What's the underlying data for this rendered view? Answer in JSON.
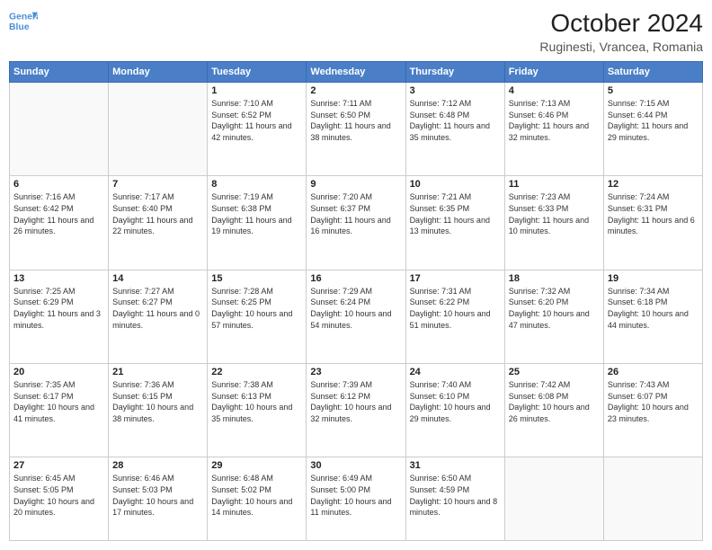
{
  "header": {
    "logo_line1": "General",
    "logo_line2": "Blue",
    "title": "October 2024",
    "subtitle": "Ruginesti, Vrancea, Romania"
  },
  "days_of_week": [
    "Sunday",
    "Monday",
    "Tuesday",
    "Wednesday",
    "Thursday",
    "Friday",
    "Saturday"
  ],
  "weeks": [
    [
      {
        "num": "",
        "info": ""
      },
      {
        "num": "",
        "info": ""
      },
      {
        "num": "1",
        "info": "Sunrise: 7:10 AM\nSunset: 6:52 PM\nDaylight: 11 hours and 42 minutes."
      },
      {
        "num": "2",
        "info": "Sunrise: 7:11 AM\nSunset: 6:50 PM\nDaylight: 11 hours and 38 minutes."
      },
      {
        "num": "3",
        "info": "Sunrise: 7:12 AM\nSunset: 6:48 PM\nDaylight: 11 hours and 35 minutes."
      },
      {
        "num": "4",
        "info": "Sunrise: 7:13 AM\nSunset: 6:46 PM\nDaylight: 11 hours and 32 minutes."
      },
      {
        "num": "5",
        "info": "Sunrise: 7:15 AM\nSunset: 6:44 PM\nDaylight: 11 hours and 29 minutes."
      }
    ],
    [
      {
        "num": "6",
        "info": "Sunrise: 7:16 AM\nSunset: 6:42 PM\nDaylight: 11 hours and 26 minutes."
      },
      {
        "num": "7",
        "info": "Sunrise: 7:17 AM\nSunset: 6:40 PM\nDaylight: 11 hours and 22 minutes."
      },
      {
        "num": "8",
        "info": "Sunrise: 7:19 AM\nSunset: 6:38 PM\nDaylight: 11 hours and 19 minutes."
      },
      {
        "num": "9",
        "info": "Sunrise: 7:20 AM\nSunset: 6:37 PM\nDaylight: 11 hours and 16 minutes."
      },
      {
        "num": "10",
        "info": "Sunrise: 7:21 AM\nSunset: 6:35 PM\nDaylight: 11 hours and 13 minutes."
      },
      {
        "num": "11",
        "info": "Sunrise: 7:23 AM\nSunset: 6:33 PM\nDaylight: 11 hours and 10 minutes."
      },
      {
        "num": "12",
        "info": "Sunrise: 7:24 AM\nSunset: 6:31 PM\nDaylight: 11 hours and 6 minutes."
      }
    ],
    [
      {
        "num": "13",
        "info": "Sunrise: 7:25 AM\nSunset: 6:29 PM\nDaylight: 11 hours and 3 minutes."
      },
      {
        "num": "14",
        "info": "Sunrise: 7:27 AM\nSunset: 6:27 PM\nDaylight: 11 hours and 0 minutes."
      },
      {
        "num": "15",
        "info": "Sunrise: 7:28 AM\nSunset: 6:25 PM\nDaylight: 10 hours and 57 minutes."
      },
      {
        "num": "16",
        "info": "Sunrise: 7:29 AM\nSunset: 6:24 PM\nDaylight: 10 hours and 54 minutes."
      },
      {
        "num": "17",
        "info": "Sunrise: 7:31 AM\nSunset: 6:22 PM\nDaylight: 10 hours and 51 minutes."
      },
      {
        "num": "18",
        "info": "Sunrise: 7:32 AM\nSunset: 6:20 PM\nDaylight: 10 hours and 47 minutes."
      },
      {
        "num": "19",
        "info": "Sunrise: 7:34 AM\nSunset: 6:18 PM\nDaylight: 10 hours and 44 minutes."
      }
    ],
    [
      {
        "num": "20",
        "info": "Sunrise: 7:35 AM\nSunset: 6:17 PM\nDaylight: 10 hours and 41 minutes."
      },
      {
        "num": "21",
        "info": "Sunrise: 7:36 AM\nSunset: 6:15 PM\nDaylight: 10 hours and 38 minutes."
      },
      {
        "num": "22",
        "info": "Sunrise: 7:38 AM\nSunset: 6:13 PM\nDaylight: 10 hours and 35 minutes."
      },
      {
        "num": "23",
        "info": "Sunrise: 7:39 AM\nSunset: 6:12 PM\nDaylight: 10 hours and 32 minutes."
      },
      {
        "num": "24",
        "info": "Sunrise: 7:40 AM\nSunset: 6:10 PM\nDaylight: 10 hours and 29 minutes."
      },
      {
        "num": "25",
        "info": "Sunrise: 7:42 AM\nSunset: 6:08 PM\nDaylight: 10 hours and 26 minutes."
      },
      {
        "num": "26",
        "info": "Sunrise: 7:43 AM\nSunset: 6:07 PM\nDaylight: 10 hours and 23 minutes."
      }
    ],
    [
      {
        "num": "27",
        "info": "Sunrise: 6:45 AM\nSunset: 5:05 PM\nDaylight: 10 hours and 20 minutes."
      },
      {
        "num": "28",
        "info": "Sunrise: 6:46 AM\nSunset: 5:03 PM\nDaylight: 10 hours and 17 minutes."
      },
      {
        "num": "29",
        "info": "Sunrise: 6:48 AM\nSunset: 5:02 PM\nDaylight: 10 hours and 14 minutes."
      },
      {
        "num": "30",
        "info": "Sunrise: 6:49 AM\nSunset: 5:00 PM\nDaylight: 10 hours and 11 minutes."
      },
      {
        "num": "31",
        "info": "Sunrise: 6:50 AM\nSunset: 4:59 PM\nDaylight: 10 hours and 8 minutes."
      },
      {
        "num": "",
        "info": ""
      },
      {
        "num": "",
        "info": ""
      }
    ]
  ]
}
